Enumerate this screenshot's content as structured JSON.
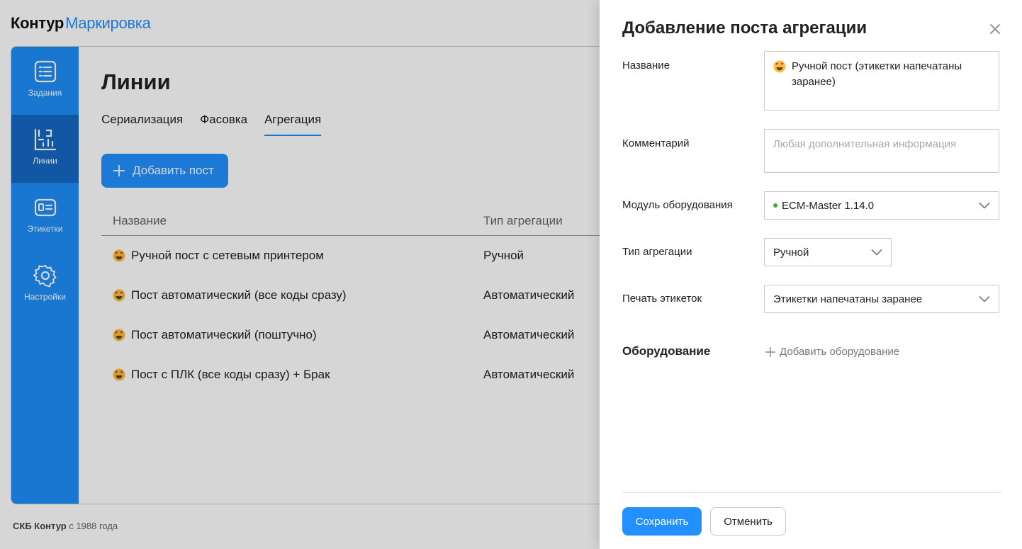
{
  "brand": {
    "part1": "Контур",
    "part2": "Маркировка"
  },
  "sidebar": {
    "items": [
      {
        "label": "Задания",
        "icon": "tasks-icon"
      },
      {
        "label": "Линии",
        "icon": "lines-icon",
        "active": true
      },
      {
        "label": "Этикетки",
        "icon": "labels-icon"
      },
      {
        "label": "Настройки",
        "icon": "gear-icon"
      }
    ]
  },
  "main": {
    "title": "Линии",
    "tabs": [
      "Сериализация",
      "Фасовка",
      "Агрегация"
    ],
    "active_tab": "Агрегация",
    "add_button": "Добавить пост",
    "table": {
      "headers": [
        "Название",
        "Тип агрегации"
      ],
      "rows": [
        {
          "name": "Ручной пост с сетевым принтером",
          "type": "Ручной"
        },
        {
          "name": "Пост автоматический (все коды сразу)",
          "type": "Автоматический"
        },
        {
          "name": "Пост автоматический (поштучно)",
          "type": "Автоматический"
        },
        {
          "name": "Пост с ПЛК (все коды сразу) + Брак",
          "type": "Автоматический"
        }
      ]
    }
  },
  "footer": {
    "company": "СКБ Контур",
    "since": "с 1988 года"
  },
  "panel": {
    "title": "Добавление поста агрегации",
    "fields": {
      "name": {
        "label": "Название",
        "value": "Ручной пост (этикетки напечатаны заранее)"
      },
      "comment": {
        "label": "Комментарий",
        "placeholder": "Любая дополнительная информация"
      },
      "module": {
        "label": "Модуль оборудования",
        "value": "ECM-Master 1.14.0",
        "status_color": "#3bb12f"
      },
      "aggregation_type": {
        "label": "Тип агрегации",
        "value": "Ручной"
      },
      "label_print": {
        "label": "Печать этикеток",
        "value": "Этикетки напечатаны заранее"
      }
    },
    "equipment": {
      "title": "Оборудование",
      "add_label": "Добавить оборудование"
    },
    "save": "Сохранить",
    "cancel": "Отменить"
  },
  "colors": {
    "accent": "#2291ff",
    "sidebar": "#1f8efa",
    "sidebar_active": "#1668c4"
  }
}
